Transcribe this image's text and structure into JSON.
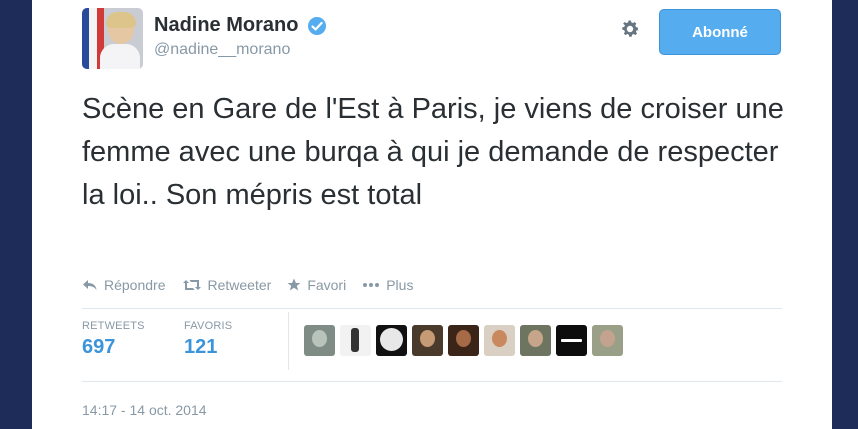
{
  "user": {
    "display_name": "Nadine Morano",
    "handle": "@nadine__morano",
    "verified": true
  },
  "icons": {
    "settings": "gear-icon",
    "verified": "verified-badge-icon"
  },
  "follow_button": {
    "label": "Abonné"
  },
  "tweet": {
    "text": "Scène en Gare de l'Est à Paris, je viens de croiser une femme avec une burqa à qui je demande de respecter la loi.. Son mépris est total"
  },
  "actions": {
    "reply": "Répondre",
    "retweet": "Retweeter",
    "favorite": "Favori",
    "more": "Plus"
  },
  "stats": {
    "retweets_label": "RETWEETS",
    "retweets_count": "697",
    "favorites_label": "FAVORIS",
    "favorites_count": "121"
  },
  "timestamp": "14:17 - 14 oct. 2014",
  "colors": {
    "accent": "#55acee",
    "link": "#3b94d9",
    "muted": "#8899a6",
    "text": "#292f33",
    "frame": "#1d2c59"
  }
}
